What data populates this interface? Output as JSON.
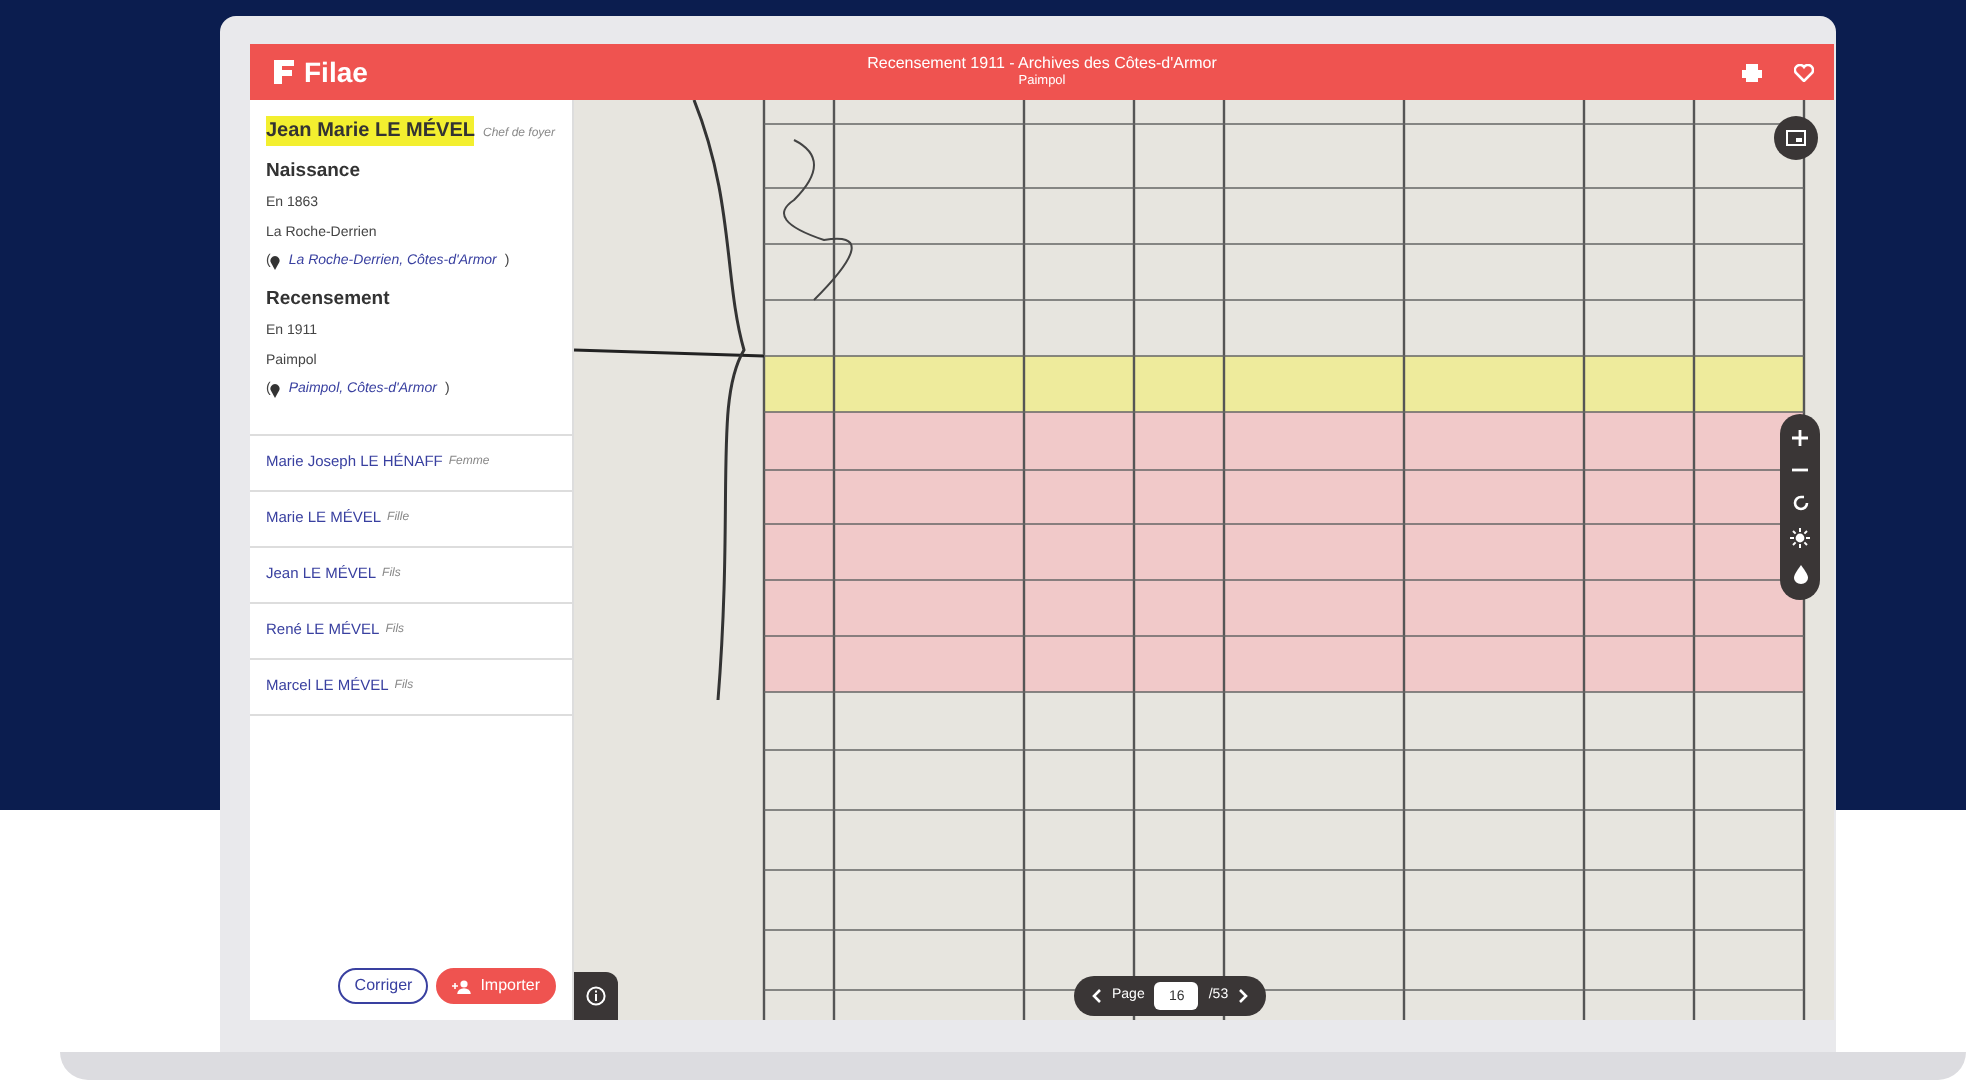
{
  "header": {
    "logo": "Filae",
    "title": "Recensement 1911 - Archives des Côtes-d'Armor",
    "subtitle": "Paimpol"
  },
  "person": {
    "name": "Jean Marie LE MÉVEL",
    "role": "Chef de foyer",
    "highlighted": true,
    "sections": [
      {
        "heading": "Naissance",
        "lines": [
          "En 1863",
          "La Roche-Derrien"
        ],
        "open": "(",
        "place": "La Roche-Derrien, Côtes-d'Armor",
        "close": ")"
      },
      {
        "heading": "Recensement",
        "lines": [
          "En 1911",
          "Paimpol"
        ],
        "open": "(",
        "place": "Paimpol, Côtes-d'Armor",
        "close": ")"
      }
    ]
  },
  "members": [
    {
      "name": "Marie Joseph LE HÉNAFF",
      "role": "Femme"
    },
    {
      "name": "Marie LE MÉVEL",
      "role": "Fille"
    },
    {
      "name": "Jean LE MÉVEL",
      "role": "Fils"
    },
    {
      "name": "René LE MÉVEL",
      "role": "Fils"
    },
    {
      "name": "Marcel LE MÉVEL",
      "role": "Fils"
    }
  ],
  "buttons": [
    {
      "label": "Corriger",
      "kind": "outline"
    },
    {
      "label": "Importer",
      "kind": "primary"
    }
  ],
  "pager": {
    "label": "Page",
    "value": "16",
    "total": "/53"
  }
}
